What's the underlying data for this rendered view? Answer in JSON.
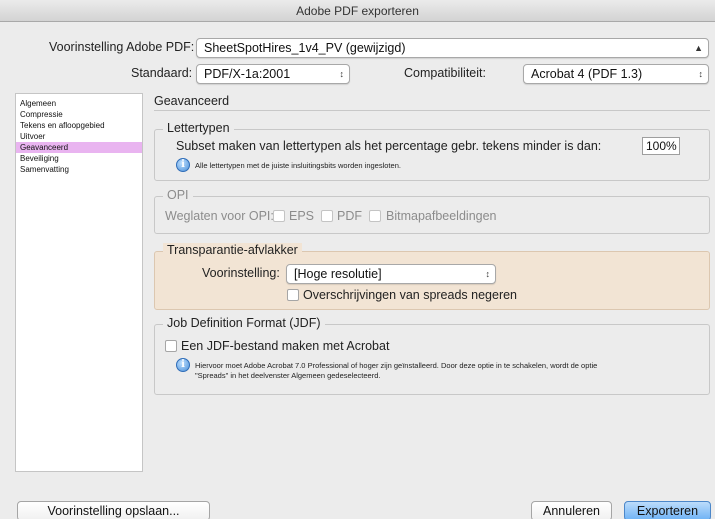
{
  "window": {
    "title": "Adobe PDF exporteren"
  },
  "preset": {
    "label": "Voorinstelling Adobe PDF:",
    "value": "SheetSpotHires_1v4_PV (gewijzigd)"
  },
  "standard": {
    "label": "Standaard:",
    "value": "PDF/X-1a:2001"
  },
  "compatibility": {
    "label": "Compatibiliteit:",
    "value": "Acrobat 4 (PDF 1.3)"
  },
  "sidebar": {
    "items": [
      {
        "label": "Algemeen"
      },
      {
        "label": "Compressie"
      },
      {
        "label": "Tekens en afloopgebied"
      },
      {
        "label": "Uitvoer"
      },
      {
        "label": "Geavanceerd",
        "selected": true
      },
      {
        "label": "Beveiliging"
      },
      {
        "label": "Samenvatting"
      }
    ],
    "selected_color": "#e9b4f0"
  },
  "panel": {
    "title": "Geavanceerd"
  },
  "fonts": {
    "legend": "Lettertypen",
    "subset_label": "Subset maken van lettertypen als het percentage gebr. tekens minder is dan:",
    "subset_value": "100%",
    "info": "Alle lettertypen met de juiste insluitingsbits worden ingesloten."
  },
  "opi": {
    "legend": "OPI",
    "omit_label": "Weglaten voor OPI:",
    "eps": "EPS",
    "pdf": "PDF",
    "bitmap": "Bitmapafbeeldingen"
  },
  "flattener": {
    "legend": "Transparantie-afvlakker",
    "preset_label": "Voorinstelling:",
    "preset_value": "[Hoge resolutie]",
    "ignore_overrides": "Overschrijvingen van spreads negeren",
    "background_color": "#f2e4d4"
  },
  "jdf": {
    "legend": "Job Definition Format (JDF)",
    "create_label": "Een JDF-bestand maken met Acrobat",
    "info_line1": "Hiervoor moet Adobe Acrobat 7.0 Professional of hoger zijn geïnstalleerd. Door deze optie in te schakelen, wordt de optie",
    "info_line2": "\"Spreads\" in het deelvenster Algemeen gedeselecteerd."
  },
  "buttons": {
    "save_preset": "Voorinstelling opslaan...",
    "cancel": "Annuleren",
    "export": "Exporteren"
  }
}
